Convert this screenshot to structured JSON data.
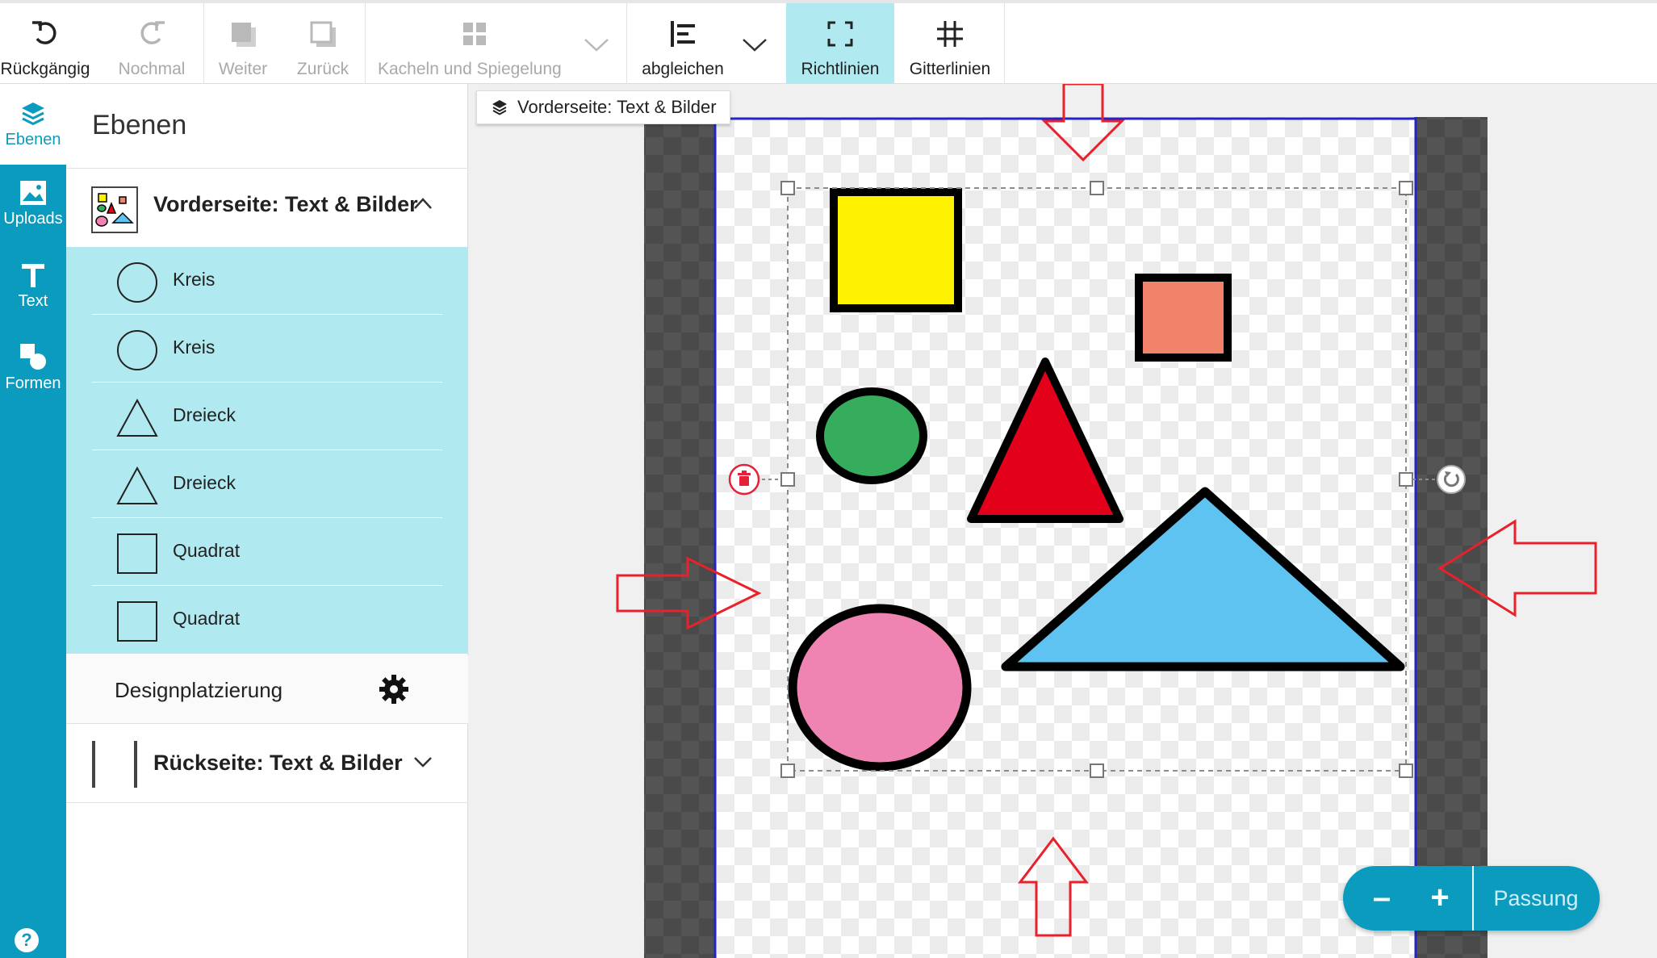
{
  "toolbar": {
    "undo": "Rückgängig",
    "redo": "Nochmal",
    "forward": "Weiter",
    "back": "Zurück",
    "tiles": "Kacheln und Spiegelung",
    "align": "abgleichen",
    "guides": "Richtlinien",
    "grid": "Gitterlinien"
  },
  "rail": {
    "layers": "Ebenen",
    "uploads": "Uploads",
    "text": "Text",
    "shapes": "Formen",
    "help": "?"
  },
  "panel": {
    "title": "Ebenen",
    "front_group": "Vorderseite: Text & Bilder",
    "layers": [
      {
        "label": "Kreis",
        "icon": "circle-icon"
      },
      {
        "label": "Kreis",
        "icon": "circle-icon"
      },
      {
        "label": "Dreieck",
        "icon": "triangle-icon"
      },
      {
        "label": "Dreieck",
        "icon": "triangle-icon"
      },
      {
        "label": "Quadrat",
        "icon": "square-icon"
      },
      {
        "label": "Quadrat",
        "icon": "square-icon"
      }
    ],
    "placement": "Designplatzierung",
    "back_group": "Rückseite: Text & Bilder"
  },
  "canvas": {
    "tab_label": "Vorderseite: Text & Bilder",
    "shape_colors": {
      "yellow_square": "#fff200",
      "salmon_square": "#f0826a",
      "green_ellipse": "#35ad5c",
      "red_triangle": "#e3001b",
      "blue_triangle": "#5fc3f1",
      "pink_ellipse": "#ef84b3"
    },
    "annotation_arrow_color": "#e8212b",
    "print_boundary_color": "#2323c8"
  },
  "zoom": {
    "minus": "–",
    "plus": "+",
    "fit": "Passung"
  },
  "colors": {
    "accent": "#0a9bbf",
    "selected_bg": "#b1e9f0"
  }
}
